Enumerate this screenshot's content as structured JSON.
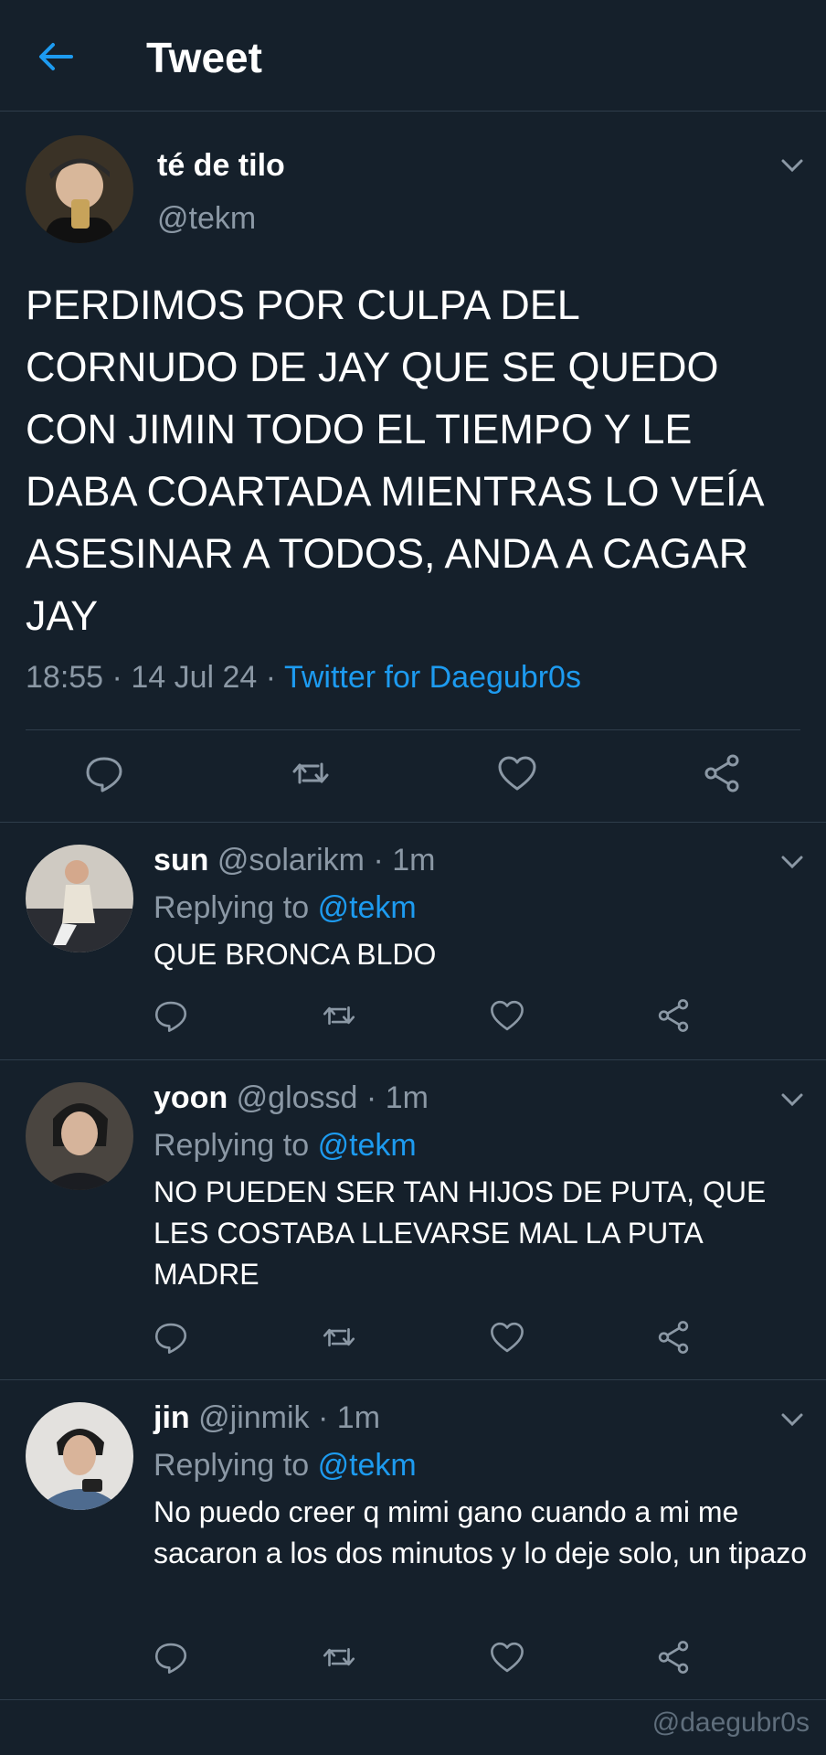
{
  "header": {
    "title": "Tweet",
    "back_icon": "arrow-left-icon",
    "accent": "#1d9bf0"
  },
  "main_tweet": {
    "name": "té de tilo",
    "handle": "@tekm",
    "text": "PERDIMOS POR CULPA DEL CORNUDO DE JAY QUE SE QUEDO CON JIMIN TODO EL TIEMPO Y LE DABA COARTADA MIENTRAS LO VEÍA ASESINAR A TODOS, ANDA A CAGAR JAY",
    "time": "18:55",
    "date": "14 Jul 24",
    "source": "Twitter for Daegubr0s",
    "actions": [
      "reply-icon",
      "retweet-icon",
      "like-icon",
      "share-icon"
    ]
  },
  "replies": [
    {
      "name": "sun",
      "handle": "@solarikm",
      "age": "1m",
      "replying_label": "Replying to",
      "mention": "@tekm",
      "text": "QUE BRONCA BLDO"
    },
    {
      "name": "yoon",
      "handle": "@glossd",
      "age": "1m",
      "replying_label": "Replying to",
      "mention": "@tekm",
      "text": "NO PUEDEN SER TAN HIJOS DE PUTA, QUE LES COSTABA LLEVARSE MAL LA PUTA MADRE"
    },
    {
      "name": "jin",
      "handle": "@jinmik",
      "age": "1m",
      "replying_label": "Replying to",
      "mention": "@tekm",
      "text": "No puedo creer q mimi gano cuando a mi me sacaron a los dos minutos y lo deje solo, un tipazo"
    }
  ],
  "watermark": "@daegubr0s",
  "colors": {
    "background": "#15202b",
    "secondary_text": "#8b98a5",
    "divider": "#2f3d4b",
    "link": "#1d9bf0"
  }
}
